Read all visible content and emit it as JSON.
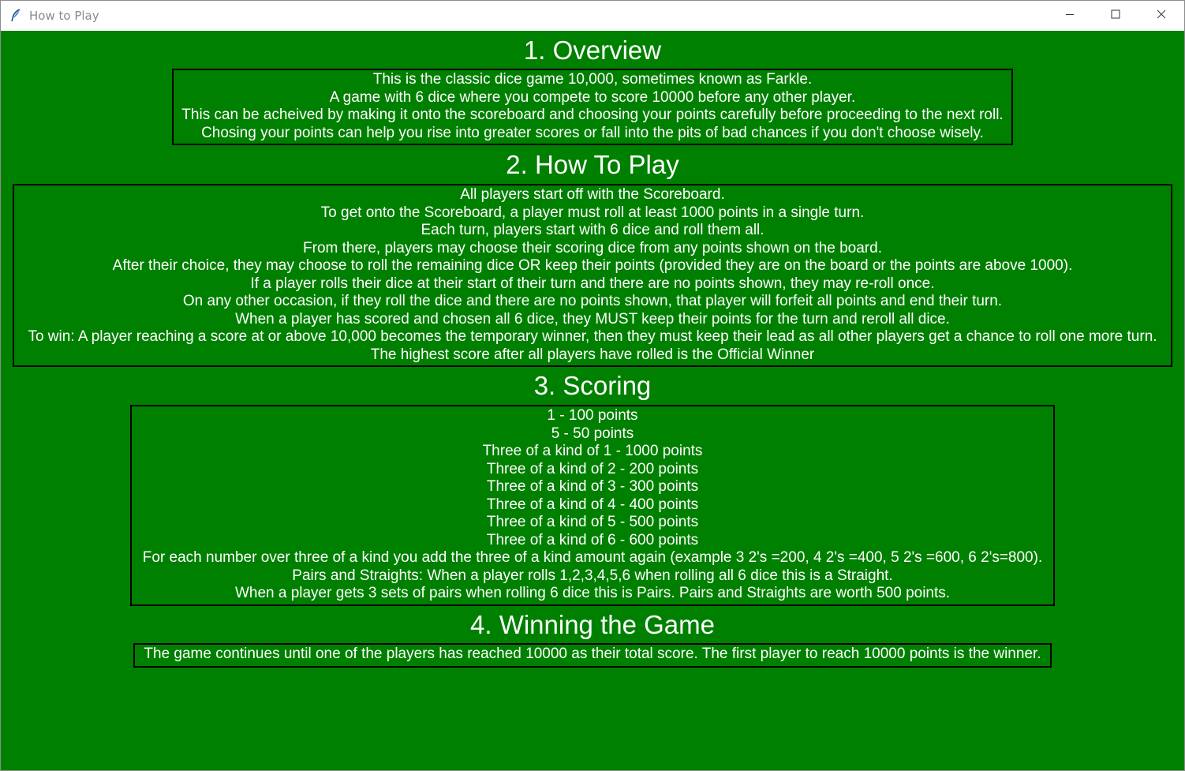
{
  "window": {
    "title": "How to Play"
  },
  "colors": {
    "background": "#008000",
    "text": "#ffffff",
    "border": "#000000"
  },
  "icons": {
    "app": "feather-icon",
    "minimize": "minimize-icon",
    "maximize": "maximize-icon",
    "close": "close-icon"
  },
  "sections": [
    {
      "heading": "1. Overview",
      "lines": [
        "This is the classic dice game 10,000, sometimes known as Farkle.",
        "A game with 6 dice where you compete to score 10000 before any other player.",
        "This can be acheived by making it onto the scoreboard and choosing your points carefully before proceeding to the next roll.",
        "Chosing your points can help you rise into greater scores or fall into the pits of bad chances if you don't choose wisely."
      ]
    },
    {
      "heading": "2. How To Play",
      "lines": [
        "All players start off with the Scoreboard.",
        "To get onto the Scoreboard, a player must roll at least 1000 points in a single turn.",
        "Each turn, players start with 6 dice and roll them all.",
        "From there, players may choose their scoring dice from any points shown on the board.",
        "After their choice, they may choose to roll the remaining dice OR keep their points (provided they are on the board or the points are above 1000).",
        "If a player rolls their dice at their start of their turn and there are no points shown, they may re-roll once.",
        "On any other occasion, if they roll the dice and there are no points shown, that player will forfeit all points and end their turn.",
        "When a player has scored and chosen all 6 dice, they MUST keep their points for the turn and reroll all dice.",
        "To win: A player reaching a score at or above 10,000 becomes the temporary winner, then they must keep their lead as all other players get a chance to roll one more turn.",
        "The highest score after all players have rolled is the Official Winner"
      ]
    },
    {
      "heading": "3. Scoring",
      "lines": [
        "1 - 100 points",
        "5 - 50 points",
        "Three of a kind of 1 - 1000 points",
        "Three of a kind of 2 - 200 points",
        "Three of a kind of 3 - 300 points",
        "Three of a kind of 4 - 400 points",
        "Three of a kind of 5 - 500 points",
        "Three of a kind of 6 - 600 points",
        "For each number over three of a kind you add the three of a kind amount again (example 3 2's =200, 4 2's =400, 5 2's =600, 6 2's=800).",
        "Pairs and Straights: When a player rolls 1,2,3,4,5,6 when rolling all 6 dice this is a Straight.",
        "When a player gets 3 sets of pairs when rolling 6 dice this is Pairs. Pairs and Straights are worth 500 points."
      ]
    },
    {
      "heading": "4. Winning the Game",
      "lines": [
        "The game continues until one of the players has reached 10000 as their total score. The first player to reach 10000 points is the winner."
      ]
    }
  ]
}
